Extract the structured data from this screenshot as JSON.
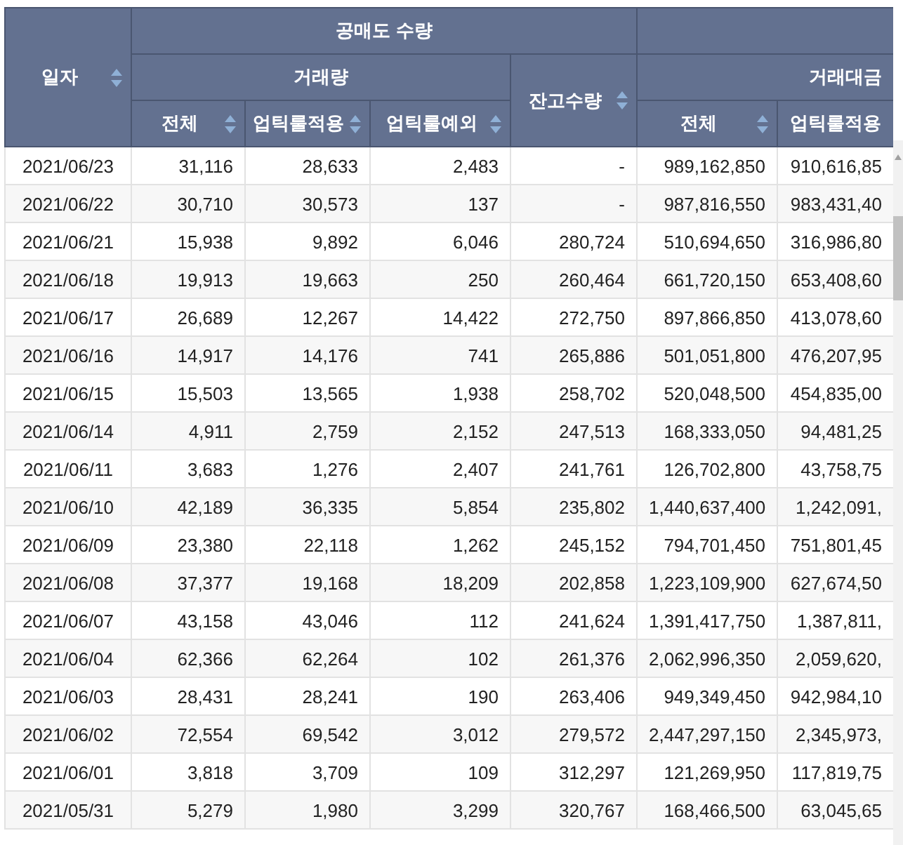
{
  "table": {
    "group_headers": [
      {
        "label": "공매도 수량"
      }
    ],
    "sub_headers": [
      {
        "label": "거래량"
      },
      {
        "label": "거래대금"
      }
    ],
    "columns": [
      {
        "label": "일자",
        "kind": "top",
        "sortable": true
      },
      {
        "label": "전체",
        "kind": "bottom",
        "sortable": true
      },
      {
        "label": "업틱룰적용",
        "kind": "bottom",
        "sortable": true
      },
      {
        "label": "업틱룰예외",
        "kind": "bottom",
        "sortable": true
      },
      {
        "label": "잔고수량",
        "kind": "middle",
        "sortable": true
      },
      {
        "label": "전체",
        "kind": "bottom",
        "sortable": true
      },
      {
        "label": "업틱룰적용",
        "kind": "bottom",
        "sortable": false
      }
    ],
    "rows": [
      [
        "2021/06/23",
        "31,116",
        "28,633",
        "2,483",
        "-",
        "989,162,850",
        "910,616,85"
      ],
      [
        "2021/06/22",
        "30,710",
        "30,573",
        "137",
        "-",
        "987,816,550",
        "983,431,40"
      ],
      [
        "2021/06/21",
        "15,938",
        "9,892",
        "6,046",
        "280,724",
        "510,694,650",
        "316,986,80"
      ],
      [
        "2021/06/18",
        "19,913",
        "19,663",
        "250",
        "260,464",
        "661,720,150",
        "653,408,60"
      ],
      [
        "2021/06/17",
        "26,689",
        "12,267",
        "14,422",
        "272,750",
        "897,866,850",
        "413,078,60"
      ],
      [
        "2021/06/16",
        "14,917",
        "14,176",
        "741",
        "265,886",
        "501,051,800",
        "476,207,95"
      ],
      [
        "2021/06/15",
        "15,503",
        "13,565",
        "1,938",
        "258,702",
        "520,048,500",
        "454,835,00"
      ],
      [
        "2021/06/14",
        "4,911",
        "2,759",
        "2,152",
        "247,513",
        "168,333,050",
        "94,481,25"
      ],
      [
        "2021/06/11",
        "3,683",
        "1,276",
        "2,407",
        "241,761",
        "126,702,800",
        "43,758,75"
      ],
      [
        "2021/06/10",
        "42,189",
        "36,335",
        "5,854",
        "235,802",
        "1,440,637,400",
        "1,242,091,"
      ],
      [
        "2021/06/09",
        "23,380",
        "22,118",
        "1,262",
        "245,152",
        "794,701,450",
        "751,801,45"
      ],
      [
        "2021/06/08",
        "37,377",
        "19,168",
        "18,209",
        "202,858",
        "1,223,109,900",
        "627,674,50"
      ],
      [
        "2021/06/07",
        "43,158",
        "43,046",
        "112",
        "241,624",
        "1,391,417,750",
        "1,387,811,"
      ],
      [
        "2021/06/04",
        "62,366",
        "62,264",
        "102",
        "261,376",
        "2,062,996,350",
        "2,059,620,"
      ],
      [
        "2021/06/03",
        "28,431",
        "28,241",
        "190",
        "263,406",
        "949,349,450",
        "942,984,10"
      ],
      [
        "2021/06/02",
        "72,554",
        "69,542",
        "3,012",
        "279,572",
        "2,447,297,150",
        "2,345,973,"
      ],
      [
        "2021/06/01",
        "3,818",
        "3,709",
        "109",
        "312,297",
        "121,269,950",
        "117,819,75"
      ],
      [
        "2021/05/31",
        "5,279",
        "1,980",
        "3,299",
        "320,767",
        "168,466,500",
        "63,045,65"
      ]
    ]
  }
}
